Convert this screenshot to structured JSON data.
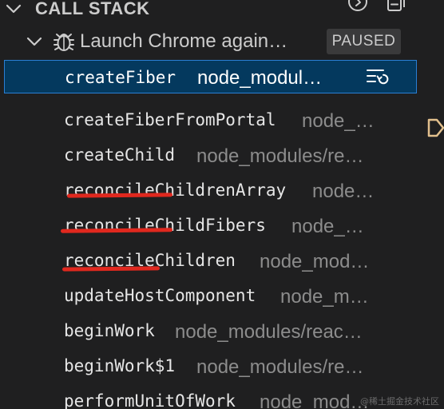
{
  "header": {
    "title": "CALL STACK",
    "icons": [
      "chevron-down-icon",
      "step-into-target-icon",
      "collapse-all-icon"
    ]
  },
  "session": {
    "label": "Launch Chrome again…",
    "status": "PAUSED",
    "icon": "bug-icon"
  },
  "frames": [
    {
      "name": "createFiber",
      "source": "node_modul…",
      "selected": true
    },
    {
      "name": "createFiberFromPortal",
      "source": "node_…"
    },
    {
      "name": "createChild",
      "source": "node_modules/re…"
    },
    {
      "name": "reconcileChildrenArray",
      "source": "node…",
      "underlined": true
    },
    {
      "name": "reconcileChildFibers",
      "source": "node_…",
      "underlined": true
    },
    {
      "name": "reconcileChildren",
      "source": "node_mod…",
      "underlined": true
    },
    {
      "name": "updateHostComponent",
      "source": "node_m…"
    },
    {
      "name": "beginWork",
      "source": "node_modules/reac…"
    },
    {
      "name": "beginWork$1",
      "source": "node_modules/re…"
    },
    {
      "name": "performUnitOfWork",
      "source": "node_mod…"
    }
  ],
  "selected_frame_action": "restart-frame-icon",
  "watermark": "@稀土掘金技术社区",
  "colors": {
    "background": "#1f1f20",
    "selection": "#04395e",
    "focus_border": "#2a7fd4",
    "annotation": "#e0281e",
    "breakpoint": "#e2c08d"
  }
}
